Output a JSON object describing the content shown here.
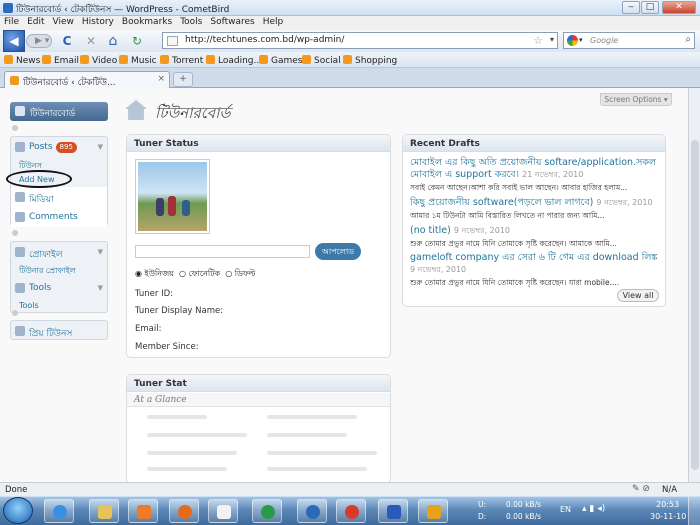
{
  "window": {
    "title": "টিউনারবোর্ড ‹ টেকটিউনস — WordPress - CometBird",
    "minimize": "‒",
    "maximize": "□",
    "close": "✕"
  },
  "menu": [
    "File",
    "Edit",
    "View",
    "History",
    "Bookmarks",
    "Tools",
    "Softwares",
    "Help"
  ],
  "nav": {
    "url": "http://techtunes.com.bd/wp-admin/",
    "search_placeholder": "Google",
    "back_icon": "back-arrow-icon",
    "reload": "C",
    "stop": "✕",
    "home": "⌂"
  },
  "bookmarks": [
    "News",
    "Email",
    "Video",
    "Music",
    "Torrent",
    "Loading...",
    "Games",
    "Social",
    "Shopping"
  ],
  "tab": {
    "label": "টিউনারবোর্ড ‹ টেকটিউ...",
    "close": "×",
    "new": "+"
  },
  "screen_options": "Screen Options ▾",
  "page_title": "টিউনারবোর্ড",
  "sidebar": {
    "dashboard": "টিউনারবোর্ড",
    "posts": "Posts",
    "posts_count": "895",
    "posts_sub": [
      "টিউনস",
      "Add New"
    ],
    "media": "মিডিয়া",
    "comments": "Comments",
    "profile": "প্রোফাইল",
    "profile_sub": "টিউনার প্রোফাইল",
    "tools": "Tools",
    "tools_sub": "Tools",
    "fav": "প্রিয় টিউনস"
  },
  "tuner_status": {
    "title": "Tuner Status",
    "button": "আপলোড",
    "radios": [
      "ইউনিজয়",
      "ফোনেটিক",
      "ডিফল্ট"
    ],
    "fields": [
      "Tuner ID:",
      "Tuner Display Name:",
      "Email:",
      "Member Since:"
    ]
  },
  "tuner_stat": {
    "title": "Tuner Stat",
    "subtitle": "At a Glance"
  },
  "drafts": {
    "title": "Recent Drafts",
    "items": [
      {
        "title": "মোবাইল এর কিছু অতি প্রয়োজনীয় softare/application.সকল মোবাইল এ support করবে।",
        "date": "21 নভেম্বর, 2010",
        "excerpt": "সবাই কেমন আছেন।আশা করি সবাই ভাল আছেন। আবার হাজির হলাম..."
      },
      {
        "title": "কিছু প্রয়োজনীয় software(পড়লে ভাল লাগবে)",
        "date": "9 নভেম্বর, 2010",
        "excerpt": "আমার ১ম টিউনটা আমি বিস্তারিত লিখতে না পারার জন্য আমি..."
      },
      {
        "title": "(no title)",
        "date": "9 নভেম্বর, 2010",
        "excerpt": "শুরু তোমার প্রভুর নামে যিনি তোমাকে সৃষ্টি করেছেন। আমাকে আমি..."
      },
      {
        "title": "gameloft company এর সেরা ৬ টি গেম এর download লিঙ্ক",
        "date": "9 নভেম্বর, 2010",
        "excerpt": "শুরু তোমার প্রভুর নামে যিনি তোমাকে সৃষ্টি করেছেন। যারা mobile...."
      }
    ],
    "view_all": "View all"
  },
  "status": {
    "text": "Done",
    "right": "N/A"
  },
  "tray": {
    "up_label": "U:",
    "down_label": "D:",
    "up": "0.00 kB/s",
    "down": "0.00 kB/s",
    "lang": "EN",
    "time": "20:53",
    "date": "30-11-10"
  }
}
